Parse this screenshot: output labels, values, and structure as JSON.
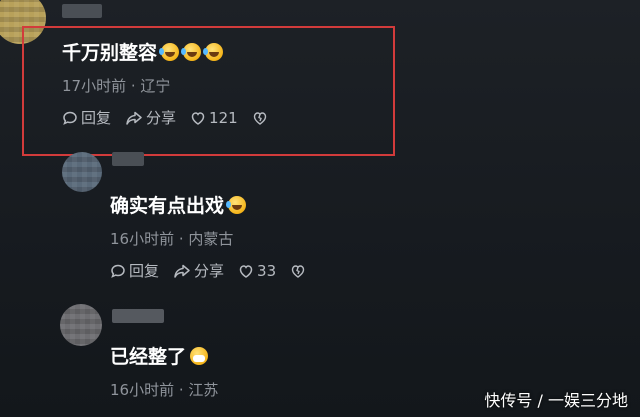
{
  "comments": [
    {
      "text": "千万别整容",
      "meta": "17小时前 · 辽宁",
      "reply": "回复",
      "share": "分享",
      "likes": "121"
    },
    {
      "text": "确实有点出戏",
      "meta": "16小时前 · 内蒙古",
      "reply": "回复",
      "share": "分享",
      "likes": "33"
    },
    {
      "text": "已经整了",
      "meta": "16小时前 · 江苏"
    }
  ],
  "watermark": "快传号 / 一娱三分地",
  "colors": {
    "highlight": "#d23b3b",
    "background": "#1a1e23"
  }
}
